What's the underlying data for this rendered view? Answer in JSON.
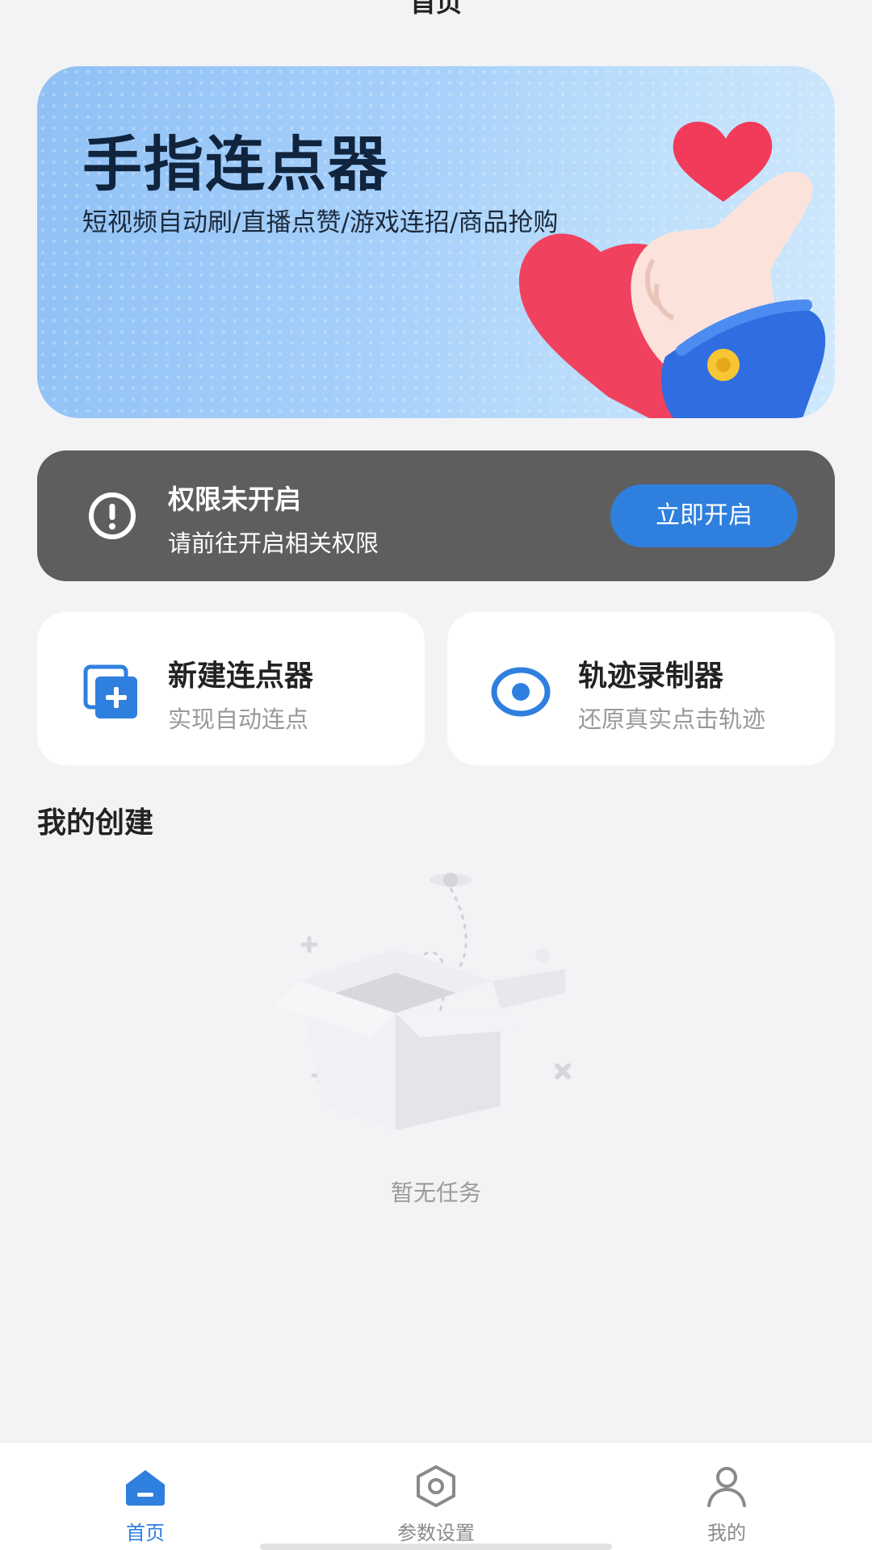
{
  "header": {
    "title": "首页"
  },
  "banner": {
    "title": "手指连点器",
    "subtitle": "短视频自动刷/直播点赞/游戏连招/商品抢购"
  },
  "permission": {
    "title": "权限未开启",
    "subtitle": "请前往开启相关权限",
    "button_label": "立即开启"
  },
  "features": [
    {
      "title": "新建连点器",
      "subtitle": "实现自动连点",
      "icon": "add-copy-icon"
    },
    {
      "title": "轨迹录制器",
      "subtitle": "还原真实点击轨迹",
      "icon": "record-icon"
    }
  ],
  "section": {
    "title": "我的创建"
  },
  "empty_state": {
    "text": "暂无任务",
    "icon": "empty-box-illustration"
  },
  "nav": {
    "items": [
      {
        "label": "首页",
        "icon": "home-icon",
        "active": true
      },
      {
        "label": "参数设置",
        "icon": "settings-icon",
        "active": false
      },
      {
        "label": "我的",
        "icon": "user-icon",
        "active": false
      }
    ]
  },
  "colors": {
    "accent": "#2f7fde",
    "permission_bg": "#5e5e5e",
    "background": "#f3f3f5"
  }
}
